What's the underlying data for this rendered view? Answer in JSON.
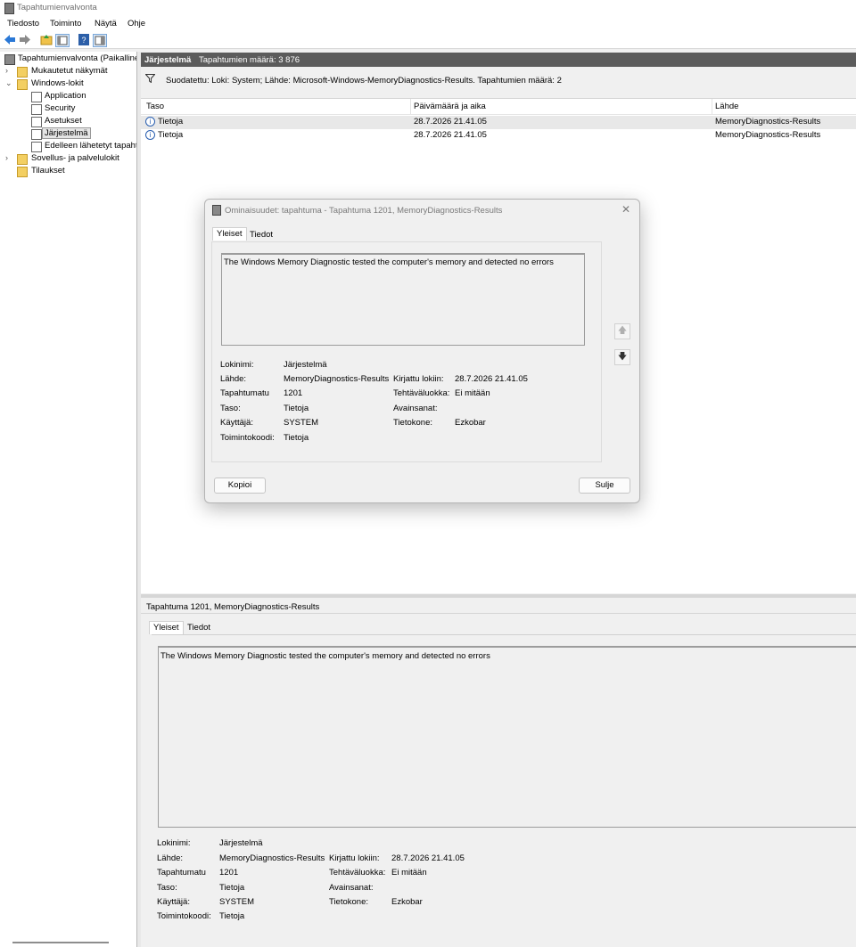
{
  "window": {
    "title": "Tapahtumienvalvonta"
  },
  "menu": [
    "Tiedosto",
    "Toiminto",
    "Näytä",
    "Ohje"
  ],
  "tree": {
    "root": "Tapahtumienvalvonta (Paikallinen)",
    "custom_views": "Mukautetut näkymät",
    "windows_logs": "Windows-lokit",
    "application": "Application",
    "security": "Security",
    "setup": "Asetukset",
    "system": "Järjestelmä",
    "forwarded": "Edelleen lähetetyt tapahtumat",
    "app_services": "Sovellus- ja palvelulokit",
    "subscriptions": "Tilaukset"
  },
  "header": {
    "log_name": "Järjestelmä",
    "event_count": "Tapahtumien määrä: 3 876"
  },
  "filter": {
    "text": "Suodatettu: Loki: System; Lähde: Microsoft-Windows-MemoryDiagnostics-Results. Tapahtumien määrä: 2"
  },
  "columns": {
    "level": "Taso",
    "datetime": "Päivämäärä ja aika",
    "source": "Lähde"
  },
  "rows": [
    {
      "level": "Tietoja",
      "datetime": "28.7.2026 21.41.05",
      "source": "MemoryDiagnostics-Results"
    },
    {
      "level": "Tietoja",
      "datetime": "28.7.2026 21.41.05",
      "source": "MemoryDiagnostics-Results"
    }
  ],
  "dialog": {
    "title": "Ominaisuudet: tapahtuma - Tapahtuma 1201, MemoryDiagnostics-Results",
    "tab_general": "Yleiset",
    "tab_details": "Tiedot",
    "description": "The Windows Memory Diagnostic tested the computer's memory and detected no errors",
    "copy_label": "Kopioi",
    "close_label": "Sulje"
  },
  "bottom": {
    "title": "Tapahtuma 1201, MemoryDiagnostics-Results",
    "tab_general": "Yleiset",
    "tab_details": "Tiedot",
    "description": "The Windows Memory Diagnostic tested the computer's memory and detected no errors"
  },
  "props": {
    "log_name_label": "Lokinimi:",
    "log_name": "Järjestelmä",
    "source_label": "Lähde:",
    "source": "MemoryDiagnostics-Results",
    "logged_label": "Kirjattu lokiin:",
    "logged": "28.7.2026 21.41.05",
    "event_id_label": "Tapahtumatu",
    "event_id": "1201",
    "task_label": "Tehtäväluokka:",
    "task": "Ei mitään",
    "level_label": "Taso:",
    "level": "Tietoja",
    "keywords_label": "Avainsanat:",
    "user_label": "Käyttäjä:",
    "user": "SYSTEM",
    "computer_label": "Tietokone:",
    "computer": "Ezkobar",
    "opcode_label": "Toimintokoodi:",
    "opcode": "Tietoja"
  }
}
